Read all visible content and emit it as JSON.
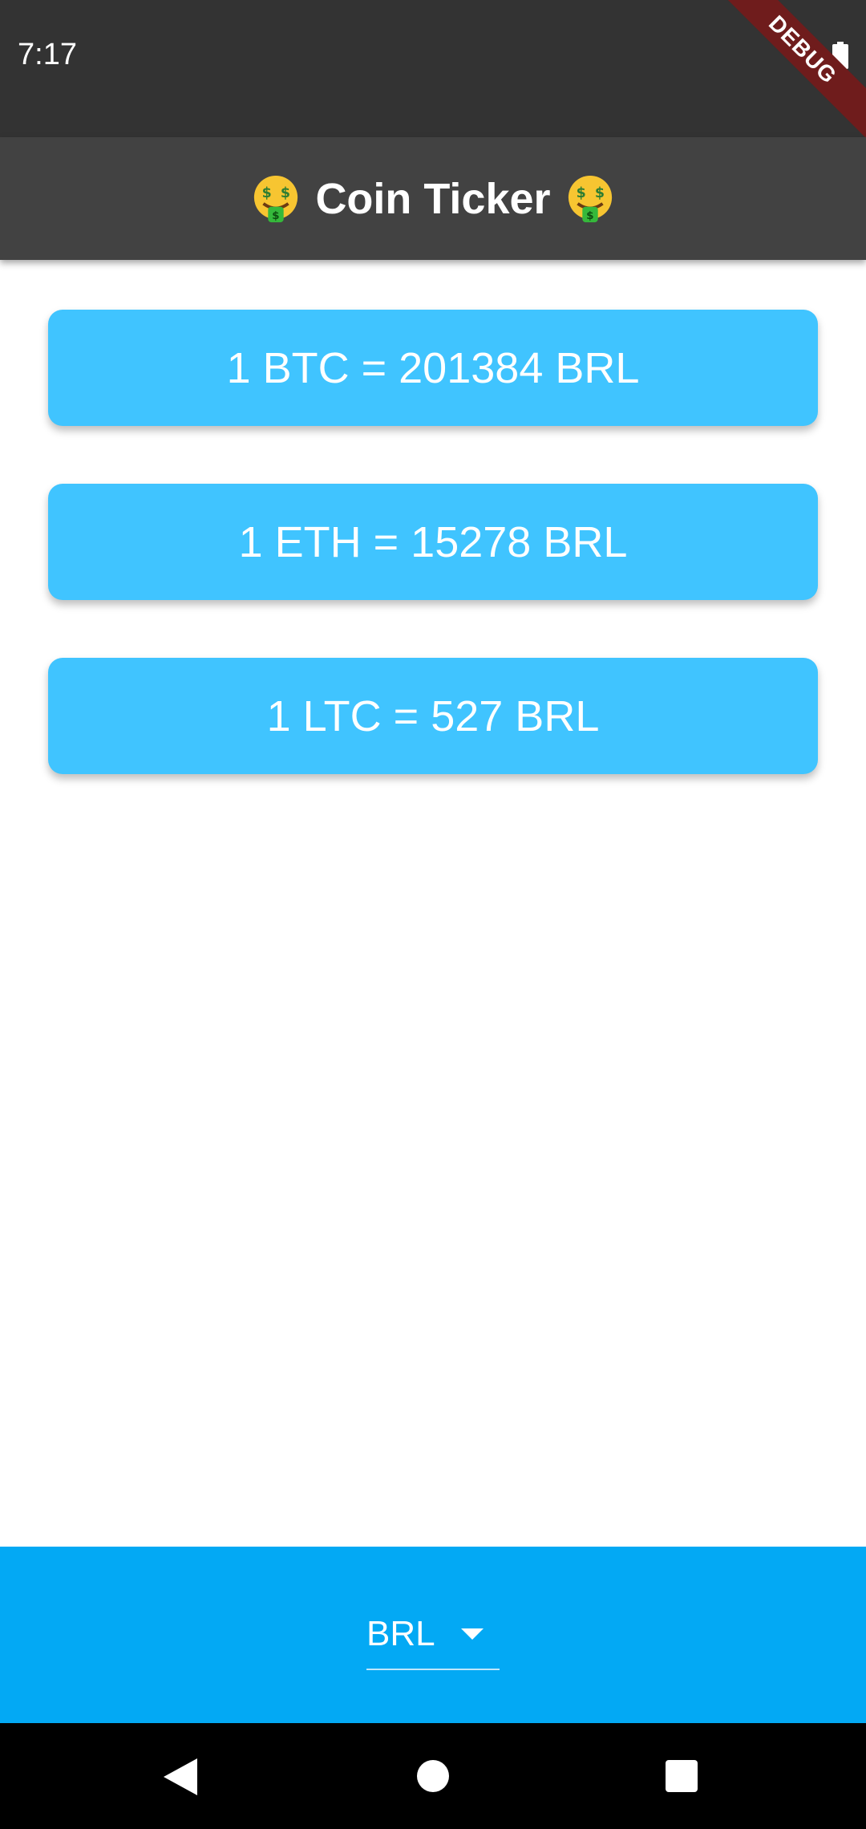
{
  "status_bar": {
    "time": "7:17",
    "battery_icon": "battery-full-icon"
  },
  "debug_banner": {
    "label": "DEBUG",
    "color": "#6f1c1c"
  },
  "app_bar": {
    "title": "Coin Ticker",
    "leading_icon": "money-mouth-face-icon",
    "trailing_icon": "money-mouth-face-icon",
    "background": "#424242"
  },
  "rates": [
    {
      "text": "1 BTC = 201384 BRL"
    },
    {
      "text": "1 ETH = 15278 BRL"
    },
    {
      "text": "1 LTC = 527 BRL"
    }
  ],
  "card_color": "#40c4ff",
  "currency_picker": {
    "selected": "BRL",
    "icon": "arrow-drop-down-icon",
    "background": "#03a9f4"
  },
  "nav_bar": {
    "back_icon": "back-triangle-icon",
    "home_icon": "home-circle-icon",
    "recents_icon": "recents-square-icon"
  }
}
